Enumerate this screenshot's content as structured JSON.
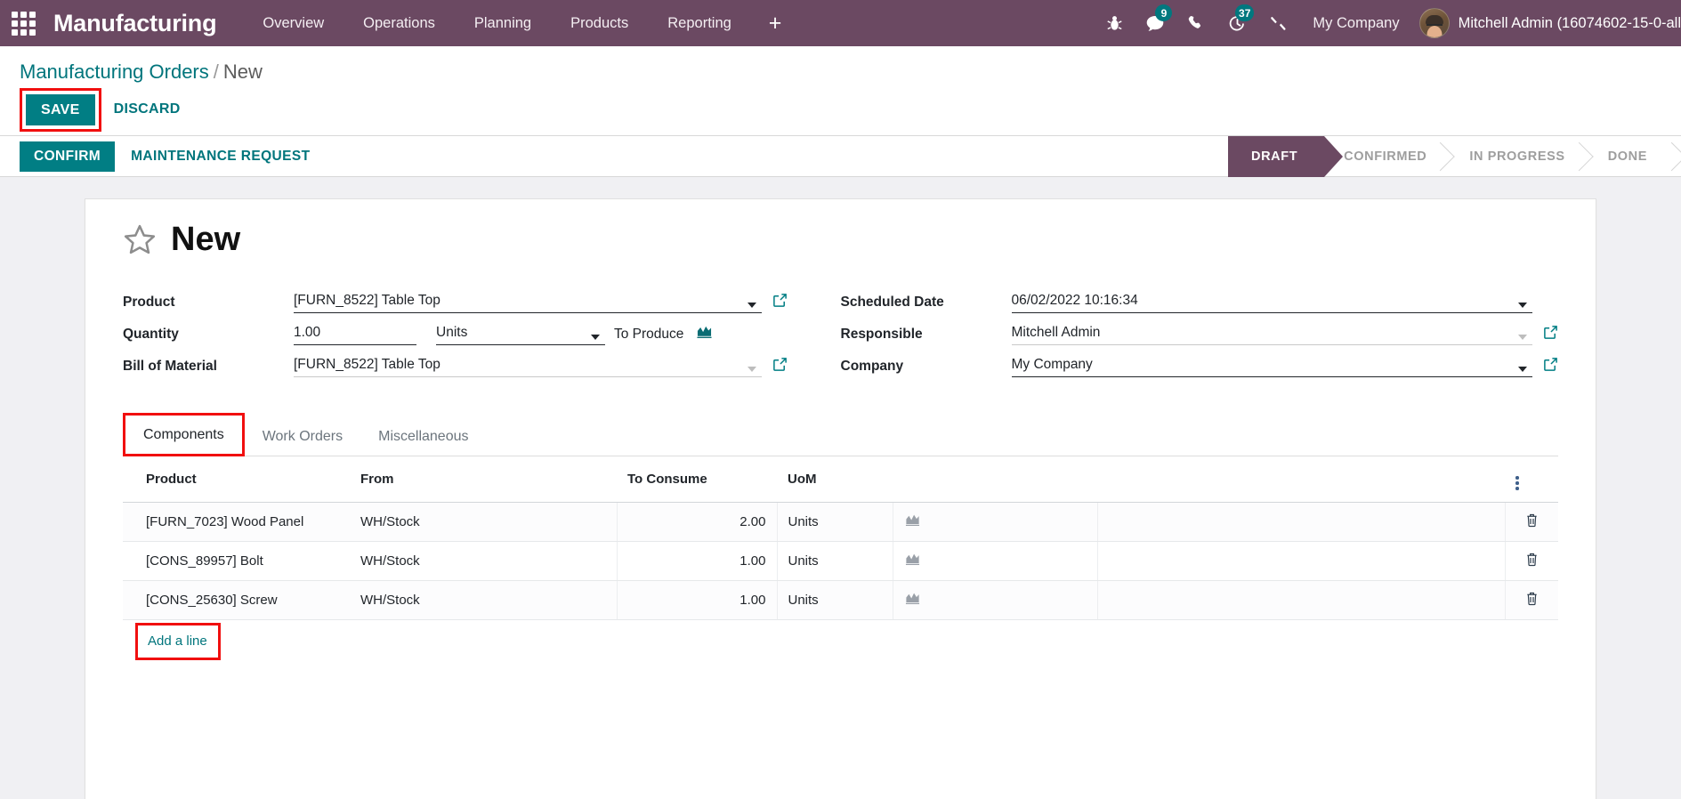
{
  "navbar": {
    "app_title": "Manufacturing",
    "menu": [
      "Overview",
      "Operations",
      "Planning",
      "Products",
      "Reporting"
    ],
    "plus_label": "+",
    "systray": [
      {
        "name": "debug-icon",
        "badge": null
      },
      {
        "name": "messages-icon",
        "badge": "9"
      },
      {
        "name": "phone-icon",
        "badge": null
      },
      {
        "name": "activities-icon",
        "badge": "37"
      },
      {
        "name": "developer-tools-icon",
        "badge": null
      }
    ],
    "company": "My Company",
    "username": "Mitchell Admin (16074602-15-0-all",
    "background_color": "#6b4962"
  },
  "breadcrumb": {
    "root": "Manufacturing Orders",
    "separator": "/",
    "current": "New"
  },
  "actions": {
    "save_label": "SAVE",
    "discard_label": "DISCARD",
    "confirm_label": "CONFIRM",
    "maintenance_label": "MAINTENANCE REQUEST",
    "primary_color": "#017e84"
  },
  "statusbar": {
    "stages": [
      "DRAFT",
      "CONFIRMED",
      "IN PROGRESS",
      "DONE"
    ],
    "active": "DRAFT",
    "active_color": "#6b4962"
  },
  "record": {
    "title": "New",
    "fields": {
      "product": {
        "label": "Product",
        "value": "[FURN_8522] Table Top"
      },
      "quantity": {
        "label": "Quantity",
        "value": "1.00",
        "uom": "Units",
        "suffix": "To Produce"
      },
      "bill_of_material": {
        "label": "Bill of Material",
        "value": "[FURN_8522] Table Top"
      },
      "scheduled_date": {
        "label": "Scheduled Date",
        "value": "06/02/2022 10:16:34"
      },
      "responsible": {
        "label": "Responsible",
        "value": "Mitchell Admin"
      },
      "company": {
        "label": "Company",
        "value": "My Company"
      }
    }
  },
  "notebook": {
    "tabs": [
      "Components",
      "Work Orders",
      "Miscellaneous"
    ],
    "active_tab": "Components"
  },
  "components_table": {
    "columns": [
      "Product",
      "From",
      "To Consume",
      "UoM"
    ],
    "rows": [
      {
        "product": "[FURN_7023] Wood Panel",
        "from": "WH/Stock",
        "to_consume": "2.00",
        "uom": "Units"
      },
      {
        "product": "[CONS_89957] Bolt",
        "from": "WH/Stock",
        "to_consume": "1.00",
        "uom": "Units"
      },
      {
        "product": "[CONS_25630] Screw",
        "from": "WH/Stock",
        "to_consume": "1.00",
        "uom": "Units"
      }
    ],
    "add_line_label": "Add a line"
  },
  "annotations": {
    "color": "#f10f0f",
    "boxes": [
      "save-button",
      "components-tab",
      "add-a-line-link"
    ]
  }
}
